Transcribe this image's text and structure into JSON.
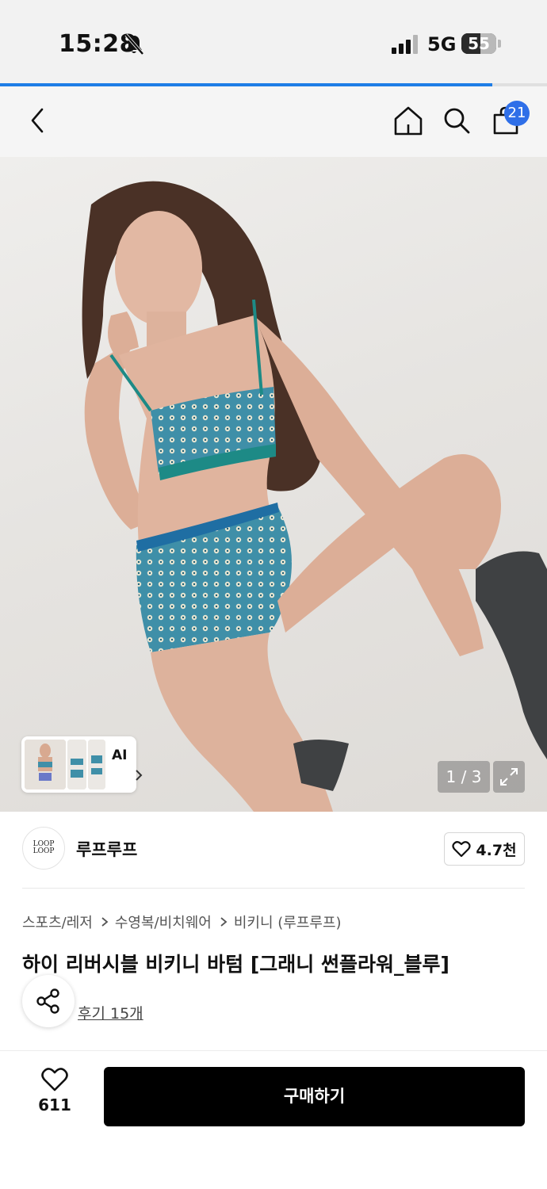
{
  "status_bar": {
    "time": "15:28",
    "network": "5G",
    "battery_level": "55",
    "battery_fraction": 0.55
  },
  "loading_progress": 0.9,
  "nav": {
    "icons": [
      "back-icon",
      "home-icon",
      "search-icon",
      "cart-icon"
    ],
    "cart_count": "21"
  },
  "gallery": {
    "ai_label": "AI",
    "indicator": "1 / 3"
  },
  "brand": {
    "logo_line1": "LOOP",
    "logo_line2": "LOOP",
    "name": "루프루프",
    "likes": "4.7천"
  },
  "breadcrumb": [
    "스포츠/레저",
    "수영복/비치웨어",
    "비키니 (루프루프)"
  ],
  "product": {
    "title": "하이 리버시블 비키니 바텀 [그래니 썬플라워_블루]",
    "review_link": "후기 15개"
  },
  "bottom_bar": {
    "wish_count": "611",
    "buy_label": "구매하기"
  },
  "colors": {
    "accent_blue": "#2f6fe8",
    "progress_blue": "#1e7de6",
    "buy_button": "#000000",
    "swimsuit_teal": "#3f8fa8"
  }
}
